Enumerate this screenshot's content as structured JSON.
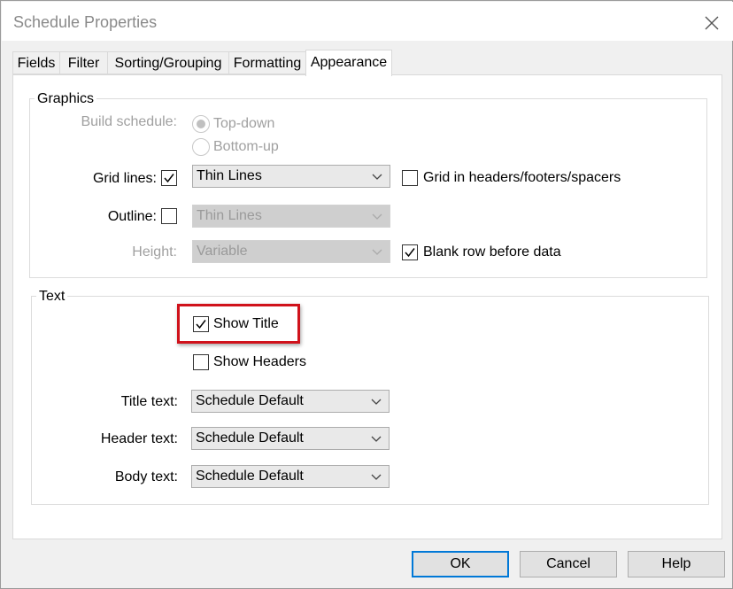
{
  "window": {
    "title": "Schedule Properties"
  },
  "tabs": [
    {
      "label": "Fields"
    },
    {
      "label": "Filter"
    },
    {
      "label": "Sorting/Grouping"
    },
    {
      "label": "Formatting"
    },
    {
      "label": "Appearance"
    }
  ],
  "active_tab": "Appearance",
  "graphics": {
    "title": "Graphics",
    "build_schedule": {
      "label": "Build schedule:",
      "options": [
        "Top-down",
        "Bottom-up"
      ],
      "selected": "Top-down"
    },
    "grid_lines": {
      "label": "Grid lines:",
      "checked": true,
      "value": "Thin Lines"
    },
    "grid_in_headers": {
      "label": "Grid in headers/footers/spacers",
      "checked": false
    },
    "outline": {
      "label": "Outline:",
      "checked": false,
      "value": "Thin Lines"
    },
    "height": {
      "label": "Height:",
      "value": "Variable"
    },
    "blank_row": {
      "label": "Blank row before data",
      "checked": true
    }
  },
  "text": {
    "title": "Text",
    "show_title": {
      "label": "Show Title",
      "checked": true
    },
    "show_headers": {
      "label": "Show Headers",
      "checked": false
    },
    "title_text": {
      "label": "Title text:",
      "value": "Schedule Default"
    },
    "header_text": {
      "label": "Header text:",
      "value": "Schedule Default"
    },
    "body_text": {
      "label": "Body text:",
      "value": "Schedule Default"
    }
  },
  "buttons": {
    "ok": "OK",
    "cancel": "Cancel",
    "help": "Help"
  },
  "colors": {
    "highlight": "#d0121b",
    "focus": "#0078d7"
  }
}
